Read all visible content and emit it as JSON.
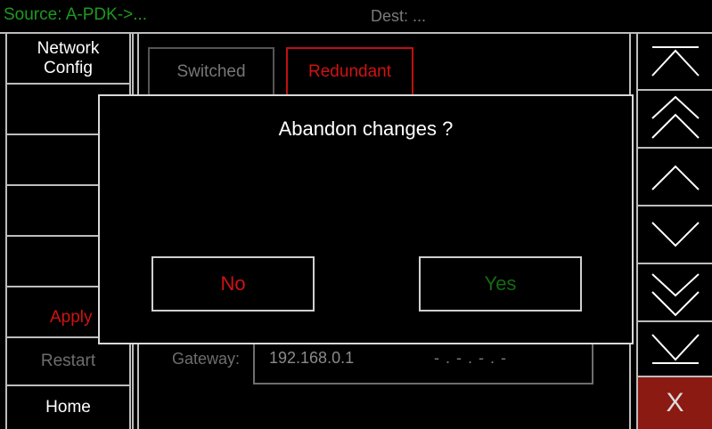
{
  "topbar": {
    "source": "Source: A-PDK->...",
    "dest": "Dest:  ..."
  },
  "left_menu": {
    "network_config": "Network\nConfig",
    "apply": "Apply",
    "restart": "Restart",
    "home": "Home"
  },
  "tabs": {
    "switched": "Switched",
    "redundant": "Redundant"
  },
  "gateway": {
    "label": "Gateway:",
    "ip": "192.168.0.1",
    "mask": "- . - . - . -"
  },
  "dialog": {
    "title": "Abandon changes ?",
    "no": "No",
    "yes": "Yes"
  },
  "right_menu": {
    "icons": [
      "scroll-top-icon",
      "page-up-icon",
      "line-up-icon",
      "line-down-icon",
      "page-down-icon",
      "scroll-bottom-icon"
    ],
    "close": "X"
  },
  "colors": {
    "source_green": "#1e9a1e",
    "red": "#d01212",
    "yes_green": "#136b13",
    "close_bg": "#8b1a13"
  }
}
